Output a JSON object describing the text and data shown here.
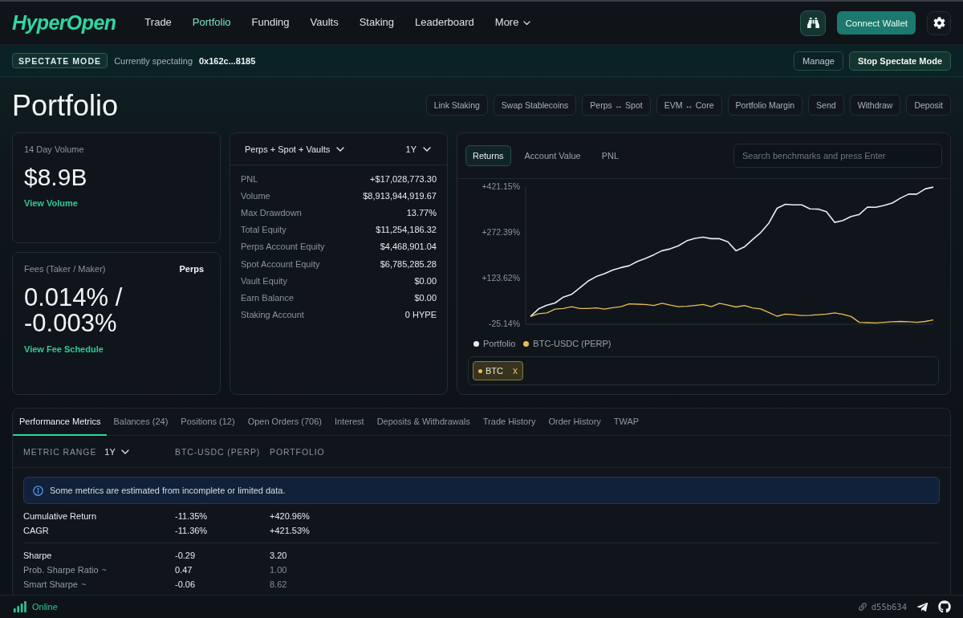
{
  "nav": {
    "logo": "HyperOpen",
    "items": [
      {
        "label": "Trade",
        "kind": "link",
        "selected": false
      },
      {
        "label": "Portfolio",
        "kind": "link",
        "selected": true
      },
      {
        "label": "Funding",
        "kind": "link",
        "selected": false
      },
      {
        "label": "Vaults",
        "kind": "link",
        "selected": false
      },
      {
        "label": "Staking",
        "kind": "link",
        "selected": false
      },
      {
        "label": "Leaderboard",
        "kind": "link",
        "selected": false
      },
      {
        "label": "More",
        "kind": "dropdown",
        "selected": false
      }
    ],
    "connect_button": "Connect Wallet"
  },
  "spectate_bar": {
    "badge": "SPECTATE MODE",
    "label": "Currently spectating",
    "address": "0x162c...8185",
    "buttons": [
      {
        "label": "Manage",
        "kind": "secondary"
      },
      {
        "label": "Stop Spectate Mode",
        "kind": "primary"
      }
    ]
  },
  "page": {
    "title": "Portfolio",
    "actions": [
      "Link Staking",
      "Swap Stablecoins",
      "Perps ↔ Spot",
      "EVM ↔ Core",
      "Portfolio Margin",
      "Send",
      "Withdraw",
      "Deposit"
    ]
  },
  "volume_card": {
    "label": "14 Day Volume",
    "value": "$8.9B",
    "link": "View Volume"
  },
  "fees_card": {
    "label": "Fees (Taker / Maker)",
    "market": "Perps",
    "value": "0.014% / -0.003%",
    "link": "View Fee Schedule"
  },
  "summary": {
    "scope": "Perps + Spot + Vaults",
    "range": "1Y",
    "rows": [
      {
        "label": "PNL",
        "value": "+$17,028,773.30"
      },
      {
        "label": "Volume",
        "value": "$8,913,944,919.67"
      },
      {
        "label": "Max Drawdown",
        "value": "13.77%"
      },
      {
        "label": "Total Equity",
        "value": "$11,254,186.32"
      },
      {
        "label": "Perps Account Equity",
        "value": "$4,468,901.04"
      },
      {
        "label": "Spot Account Equity",
        "value": "$6,785,285.28"
      },
      {
        "label": "Vault Equity",
        "value": "$0.00"
      },
      {
        "label": "Earn Balance",
        "value": "$0.00"
      },
      {
        "label": "Staking Account",
        "value": "0 HYPE"
      }
    ]
  },
  "chart_panel": {
    "tabs": [
      {
        "label": "Returns",
        "selected": true
      },
      {
        "label": "Account Value",
        "selected": false
      },
      {
        "label": "PNL",
        "selected": false
      }
    ],
    "search": {
      "placeholder": "Search benchmarks and press Enter"
    },
    "chart_data": {
      "type": "line",
      "ylim": [
        -25.14,
        421.15
      ],
      "yticks": [
        {
          "value": 421.15,
          "label": "+421.15%"
        },
        {
          "value": 272.39,
          "label": "+272.39%"
        },
        {
          "value": 123.62,
          "label": "+123.62%"
        },
        {
          "value": -25.14,
          "label": "-25.14%"
        }
      ],
      "series": [
        {
          "name": "Portfolio",
          "color": "#e9ecef",
          "values": [
            0,
            25,
            37,
            44,
            63,
            72,
            93,
            115,
            130,
            139,
            151,
            159,
            165,
            179,
            189,
            201,
            214,
            220,
            230,
            246,
            254,
            258,
            253,
            253,
            243,
            214,
            226,
            250,
            273,
            304,
            352,
            365,
            363,
            363,
            350,
            349,
            341,
            306,
            312,
            325,
            332,
            356,
            355,
            361,
            369,
            385,
            398,
            398,
            415,
            421
          ]
        },
        {
          "name": "BTC-USDC (PERP)",
          "color": "#e8bd52",
          "values": [
            0,
            9,
            12,
            24,
            26,
            32,
            26,
            26,
            28,
            24,
            29,
            32,
            41,
            40,
            39,
            36,
            43,
            37,
            32,
            33,
            36,
            39,
            32,
            43,
            37,
            31,
            36,
            28,
            25,
            13,
            1,
            8,
            6,
            3,
            4,
            6,
            8,
            12,
            7,
            0,
            -19,
            -20,
            -21,
            -19,
            -17,
            -16,
            -17,
            -19,
            -16,
            -11
          ]
        }
      ]
    },
    "benchmarks": [
      {
        "label": "BTC",
        "remove": "x",
        "color": "#e8bd52"
      }
    ]
  },
  "bottom_tabs": [
    {
      "label": "Performance Metrics",
      "selected": true
    },
    {
      "label": "Balances (24)",
      "selected": false
    },
    {
      "label": "Positions (12)",
      "selected": false
    },
    {
      "label": "Open Orders (706)",
      "selected": false
    },
    {
      "label": "Interest",
      "selected": false
    },
    {
      "label": "Deposits & Withdrawals",
      "selected": false
    },
    {
      "label": "Trade History",
      "selected": false
    },
    {
      "label": "Order History",
      "selected": false
    },
    {
      "label": "TWAP",
      "selected": false
    }
  ],
  "metrics": {
    "range_label": "METRIC RANGE",
    "range": "1Y",
    "columns": [
      "BTC-USDC (PERP)",
      "PORTFOLIO"
    ],
    "notice": "Some metrics are estimated from incomplete or limited data.",
    "groups": [
      {
        "rows": [
          {
            "label": "Cumulative Return",
            "estimated": false,
            "benchmark": "-11.35%",
            "portfolio": "+420.96%"
          },
          {
            "label": "CAGR",
            "estimated": false,
            "benchmark": "-11.36%",
            "portfolio": "+421.53%"
          }
        ]
      },
      {
        "rows": [
          {
            "label": "Sharpe",
            "estimated": false,
            "benchmark": "-0.29",
            "portfolio": "3.20"
          },
          {
            "label": "Prob. Sharpe Ratio",
            "estimated": true,
            "marker": "~",
            "benchmark": "0.47",
            "portfolio": "1.00"
          },
          {
            "label": "Smart Sharpe",
            "estimated": true,
            "marker": "~",
            "benchmark": "-0.06",
            "portfolio": "8.62"
          }
        ]
      }
    ]
  },
  "status_bar": {
    "connection": "Online",
    "build": "d55b634"
  }
}
